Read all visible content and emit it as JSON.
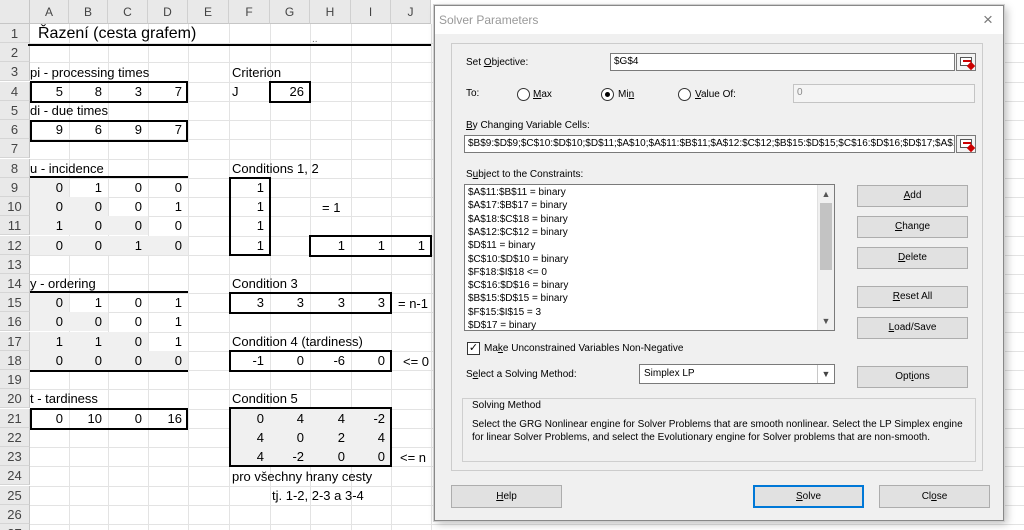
{
  "sheet": {
    "columns": [
      "A",
      "B",
      "C",
      "D",
      "E",
      "F",
      "G",
      "H",
      "I",
      "J"
    ],
    "rows": [
      "1",
      "2",
      "3",
      "4",
      "5",
      "6",
      "7",
      "8",
      "9",
      "10",
      "11",
      "12",
      "13",
      "14",
      "15",
      "16",
      "17",
      "18",
      "19",
      "20",
      "21",
      "22",
      "23",
      "24",
      "25",
      "26",
      "27"
    ],
    "title": "Řazení  (cesta grafem)",
    "dots": "..",
    "pi_label": "pi  - processing times",
    "pi_values": [
      "5",
      "8",
      "3",
      "7"
    ],
    "di_label": "di  - due times",
    "di_values": [
      "9",
      "6",
      "9",
      "7"
    ],
    "u_label": "u  - incidence",
    "u_matrix": [
      [
        "0",
        "1",
        "0",
        "0"
      ],
      [
        "0",
        "0",
        "0",
        "1"
      ],
      [
        "1",
        "0",
        "0",
        "0"
      ],
      [
        "0",
        "0",
        "1",
        "0"
      ]
    ],
    "y_label": "y  - ordering",
    "y_matrix": [
      [
        "0",
        "1",
        "0",
        "1"
      ],
      [
        "0",
        "0",
        "0",
        "1"
      ],
      [
        "1",
        "1",
        "0",
        "1"
      ],
      [
        "0",
        "0",
        "0",
        "0"
      ]
    ],
    "t_label": "t  - tardiness",
    "t_values": [
      "0",
      "10",
      "0",
      "16"
    ],
    "criterion_label": "Criterion",
    "criterion_name": "J",
    "criterion_value": "26",
    "cond12_label": "Conditions 1, 2",
    "cond12_col": [
      "1",
      "1",
      "1",
      "1"
    ],
    "cond12_row": [
      "1",
      "1",
      "1"
    ],
    "eq1": "= 1",
    "cond3_label": "Condition 3",
    "cond3_values": [
      "3",
      "3",
      "3",
      "3"
    ],
    "cond3_rhs": "= n-1",
    "cond4_label": "Condition 4 (tardiness)",
    "cond4_values": [
      "-1",
      "0",
      "-6",
      "0"
    ],
    "cond4_rhs": "<= 0",
    "cond5_label": "Condition 5",
    "cond5_matrix": [
      [
        "0",
        "4",
        "4",
        "-2"
      ],
      [
        "4",
        "0",
        "2",
        "4"
      ],
      [
        "4",
        "-2",
        "0",
        "0"
      ]
    ],
    "cond5_rhs": "<= n",
    "note1": "pro všechny hrany cesty",
    "note2": "tj. 1-2, 2-3 a 3-4"
  },
  "dialog": {
    "title": "Solver Parameters",
    "set_objective_pre": "Set ",
    "set_objective_u": "O",
    "set_objective_post": "bjective:",
    "objective_value": "$G$4",
    "to_label": "To:",
    "opt_max_u": "M",
    "opt_max_rest": "ax",
    "opt_min_pre": "Mi",
    "opt_min_u": "n",
    "opt_value_u": "V",
    "opt_value_rest": "alue Of:",
    "value_of": "0",
    "changing_u": "B",
    "changing_rest": "y Changing Variable Cells:",
    "changing_value": "$B$9:$D$9;$C$10:$D$10;$D$11;$A$10;$A$11:$B$11;$A$12:$C$12;$B$15:$D$15;$C$16:$D$16;$D$17;$A$16;$A$17",
    "constraints_pre": "S",
    "constraints_u": "u",
    "constraints_rest": "bject to the Constraints:",
    "constraints": [
      "$A$11:$B$11 = binary",
      "$A$17:$B$17 = binary",
      "$A$18:$C$18 = binary",
      "$A$12:$C$12 = binary",
      "$D$11 = binary",
      "$C$10:$D$10 = binary",
      "$F$18:$I$18 <= 0",
      "$C$16:$D$16 = binary",
      "$B$15:$D$15 = binary",
      "$F$15:$I$15 = 3",
      "$D$17 = binary"
    ],
    "btn_add_u": "A",
    "btn_add_rest": "dd",
    "btn_change_u": "C",
    "btn_change_rest": "hange",
    "btn_delete_u": "D",
    "btn_delete_rest": "elete",
    "btn_reset_u": "R",
    "btn_reset_rest": "eset All",
    "btn_loadsave_u": "L",
    "btn_loadsave_rest": "oad/Save",
    "unconstrained_pre": "Ma",
    "unconstrained_u": "k",
    "unconstrained_rest": "e Unconstrained Variables Non-Negative",
    "unconstrained_checked": "✓",
    "method_pre": "S",
    "method_u": "e",
    "method_rest": "lect a Solving Method:",
    "method_value": "Simplex LP",
    "btn_options_pre": "Opt",
    "btn_options_u": "i",
    "btn_options_rest": "ons",
    "group_title": "Solving Method",
    "group_text": "Select the GRG Nonlinear engine for Solver Problems that are smooth nonlinear. Select the LP Simplex engine for linear Solver Problems, and select the Evolutionary engine for Solver problems that are non-smooth.",
    "btn_help_u": "H",
    "btn_help_rest": "elp",
    "btn_solve_u": "S",
    "btn_solve_rest": "olve",
    "btn_close_pre": "Cl",
    "btn_close_u": "o",
    "btn_close_rest": "se",
    "close_glyph": "×"
  }
}
